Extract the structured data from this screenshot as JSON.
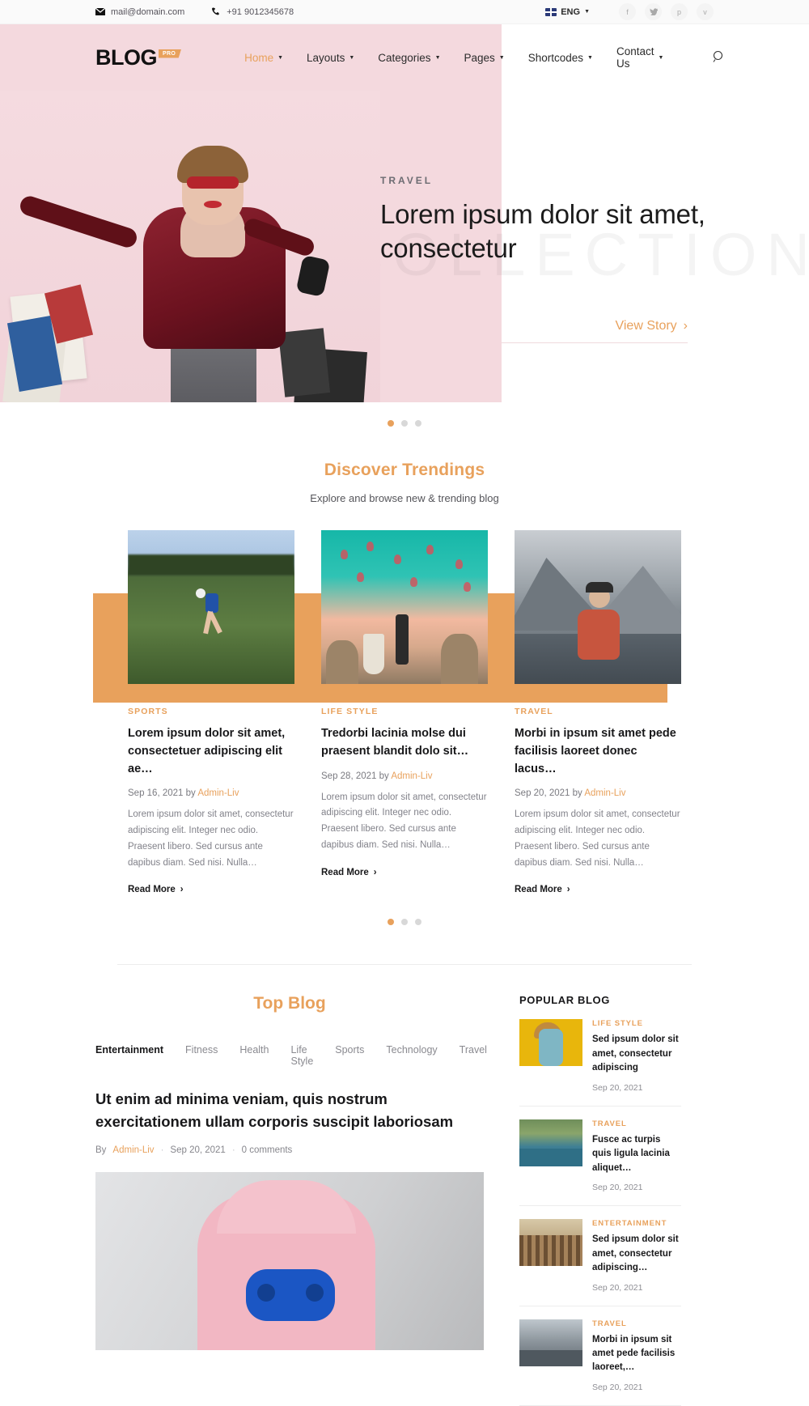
{
  "topbar": {
    "email": "mail@domain.com",
    "phone": "+91 9012345678",
    "language": "ENG",
    "socials": [
      {
        "name": "facebook-icon",
        "glyph": "f"
      },
      {
        "name": "twitter-icon",
        "glyph": "ᵛ"
      },
      {
        "name": "pinterest-icon",
        "glyph": "p"
      },
      {
        "name": "vimeo-icon",
        "glyph": "v"
      }
    ]
  },
  "header": {
    "logo_text": "BLOG",
    "logo_badge": "PRO",
    "nav": [
      {
        "label": "Home",
        "active": true
      },
      {
        "label": "Layouts",
        "active": false
      },
      {
        "label": "Categories",
        "active": false
      },
      {
        "label": "Pages",
        "active": false
      },
      {
        "label": "Shortcodes",
        "active": false
      },
      {
        "label": "Contact Us",
        "active": false
      }
    ],
    "search_icon": "search-icon"
  },
  "hero": {
    "watermark": "COLLECTION",
    "category": "TRAVEL",
    "title": "Lorem ipsum dolor sit amet, consectetur",
    "cta": "View Story",
    "cta_arrow": "›",
    "slide_count": 3,
    "active_slide": 1
  },
  "discover": {
    "title": "Discover Trendings",
    "subtitle": "Explore and browse new & trending blog",
    "slide_count": 3,
    "active_slide": 1,
    "cards": [
      {
        "category": "SPORTS",
        "title": "Lorem ipsum dolor sit amet, consectetuer adipiscing elit ae…",
        "date": "Sep 16, 2021",
        "by": "by",
        "author": "Admin-Liv",
        "desc": "Lorem ipsum dolor sit amet, consectetur adipiscing elit. Integer nec odio. Praesent libero. Sed cursus ante dapibus diam. Sed nisi. Nulla…",
        "read_more": "Read More"
      },
      {
        "category": "LIFE STYLE",
        "title": "Tredorbi lacinia molse dui praesent blandit dolo sit…",
        "date": "Sep 28, 2021",
        "by": "by",
        "author": "Admin-Liv",
        "desc": "Lorem ipsum dolor sit amet, consectetur adipiscing elit. Integer nec odio. Praesent libero. Sed cursus ante dapibus diam. Sed nisi. Nulla…",
        "read_more": "Read More"
      },
      {
        "category": "TRAVEL",
        "title": "Morbi in ipsum sit amet pede facilisis laoreet donec lacus…",
        "date": "Sep 20, 2021",
        "by": "by",
        "author": "Admin-Liv",
        "desc": "Lorem ipsum dolor sit amet, consectetur adipiscing elit. Integer nec odio. Praesent libero. Sed cursus ante dapibus diam. Sed nisi. Nulla…",
        "read_more": "Read More"
      }
    ]
  },
  "top_blog": {
    "title": "Top Blog",
    "tabs": [
      {
        "label": "Entertainment",
        "active": true
      },
      {
        "label": "Fitness",
        "active": false
      },
      {
        "label": "Health",
        "active": false
      },
      {
        "label": "Life Style",
        "active": false
      },
      {
        "label": "Sports",
        "active": false
      },
      {
        "label": "Technology",
        "active": false
      },
      {
        "label": "Travel",
        "active": false
      }
    ],
    "post": {
      "title": "Ut enim ad minima veniam, quis nostrum exercitationem ullam corporis suscipit laboriosam",
      "by_label": "By",
      "author": "Admin-Liv",
      "date": "Sep 20, 2021",
      "comments": "0 comments"
    }
  },
  "sidebar": {
    "title": "POPULAR BLOG",
    "items": [
      {
        "category": "LIFE STYLE",
        "title": "Sed ipsum dolor sit amet, consectetur adipiscing",
        "date": "Sep 20, 2021",
        "thumb": "th-yellow"
      },
      {
        "category": "TRAVEL",
        "title": "Fusce ac turpis quis ligula lacinia aliquet…",
        "date": "Sep 20, 2021",
        "thumb": "th-lagoon"
      },
      {
        "category": "ENTERTAINMENT",
        "title": "Sed ipsum dolor sit amet, consectetur adipiscing…",
        "date": "Sep 20, 2021",
        "thumb": "th-crowd"
      },
      {
        "category": "TRAVEL",
        "title": "Morbi in ipsum sit amet pede facilisis laoreet,…",
        "date": "Sep 20, 2021",
        "thumb": "th-mount"
      }
    ]
  },
  "colors": {
    "accent": "#e8a15c",
    "pink": "#f4d9de",
    "text": "#18181a",
    "muted": "#82828a"
  }
}
